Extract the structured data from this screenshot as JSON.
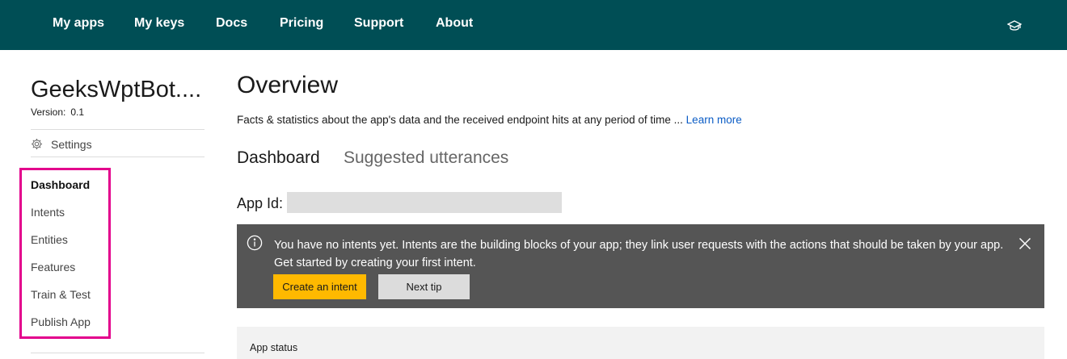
{
  "topnav": {
    "items": [
      "My apps",
      "My keys",
      "Docs",
      "Pricing",
      "Support",
      "About"
    ],
    "right_icon": "graduation-cap-icon"
  },
  "sidebar": {
    "app_name": "GeeksWptBot....",
    "version_label": "Version:",
    "version_value": "0.1",
    "settings_label": "Settings",
    "settings_icon": "gear-icon",
    "items": [
      {
        "label": "Dashboard",
        "active": true
      },
      {
        "label": "Intents",
        "active": false
      },
      {
        "label": "Entities",
        "active": false
      },
      {
        "label": "Features",
        "active": false
      },
      {
        "label": "Train & Test",
        "active": false
      },
      {
        "label": "Publish App",
        "active": false
      }
    ],
    "highlight_color": "#e3008c"
  },
  "main": {
    "title": "Overview",
    "description": "Facts & statistics about the app's data and the received endpoint hits at any period of time ...",
    "learn_more": "Learn more",
    "tabs": [
      {
        "label": "Dashboard",
        "active": true
      },
      {
        "label": "Suggested utterances",
        "active": false
      }
    ],
    "app_id_label": "App Id:",
    "app_id_value": "",
    "tip": {
      "text": "You have no intents yet. Intents are the building blocks of your app; they link user requests with the actions that should be taken by your app. Get started by creating your first intent.",
      "primary_button": "Create an intent",
      "secondary_button": "Next tip"
    },
    "status_panel_label": "App status"
  },
  "colors": {
    "nav_background": "#004e55",
    "accent_button": "#ffb900",
    "tip_background": "#555555",
    "link": "#0b5cc5"
  }
}
